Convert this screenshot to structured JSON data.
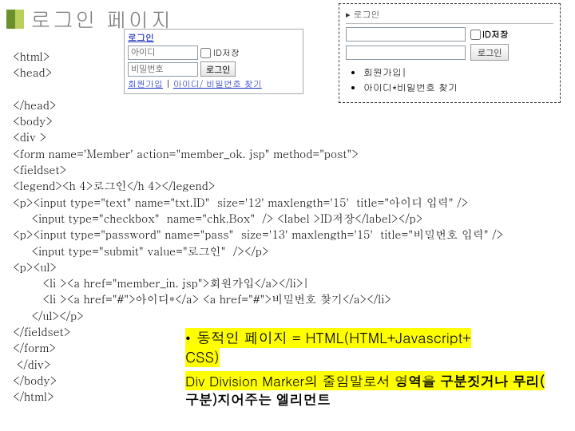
{
  "title": "로그인 페이지",
  "login1": {
    "legend": "로그인",
    "id_placeholder": "아이디",
    "pw_placeholder": "비밀번호",
    "chk_label": "ID저장",
    "submit": "로그인",
    "link_join": "회원가입",
    "link_find": "아이디/ 비밀번호 찾기",
    "sep": " | "
  },
  "login2": {
    "header": "로그인",
    "chk_label": "ID저장",
    "submit": "로그인",
    "li1": "회원가입|",
    "li2": "아이디*비밀번호 찾기"
  },
  "code": {
    "l01": "<html>",
    "l02": "<head>",
    "l03": "",
    "l04": "</head>",
    "l05": "<body>",
    "l06": "<div >",
    "l07": "<form name='Member' action=\"member_ok. jsp\" method=\"post\">",
    "l08": "<fieldset>",
    "l09": "<legend><h 4>로그인</h 4></legend>",
    "l10": "<p><input type=\"text\" name=\"txt.ID\"  size='12' maxlength='15'  title=\"아이디 입력\" />",
    "l11": "     <input type=\"checkbox\"  name=\"chk.Box\"  /> <label >ID저장</label></p>",
    "l12": "<p><input type=\"password\" name=\"pass\"  size='13' maxlength='15'  title=\"비밀번호 입력\" />",
    "l13": "     <input type=\"submit\" value=\"로그인\"  /></p>",
    "l14": "<p><ul>",
    "l15": "        <li ><a href=\"member_in. jsp\">회원가입</a></li>|",
    "l16": "        <li ><a href=\"#\">아이디*</a> <a href=\"#\">비밀번호 찾기</a></li>",
    "l17": "     </ul></p>",
    "l18": "</fieldset>",
    "l19": "</form>",
    "l20": " </div>",
    "l21": "</body>",
    "l22": "</html>"
  },
  "note1": {
    "bullet": "•",
    "text_a": "동적인 페이지  = HTML(HTML+Javascript+",
    "text_b": "CSS)"
  },
  "note2": {
    "text_a": "Div Division Marker의 줄임말로서 ",
    "text_b_bold": "영역을 구분짓거나 무리(",
    "text_c_bold": "구분)지어주는 엘리먼트"
  }
}
